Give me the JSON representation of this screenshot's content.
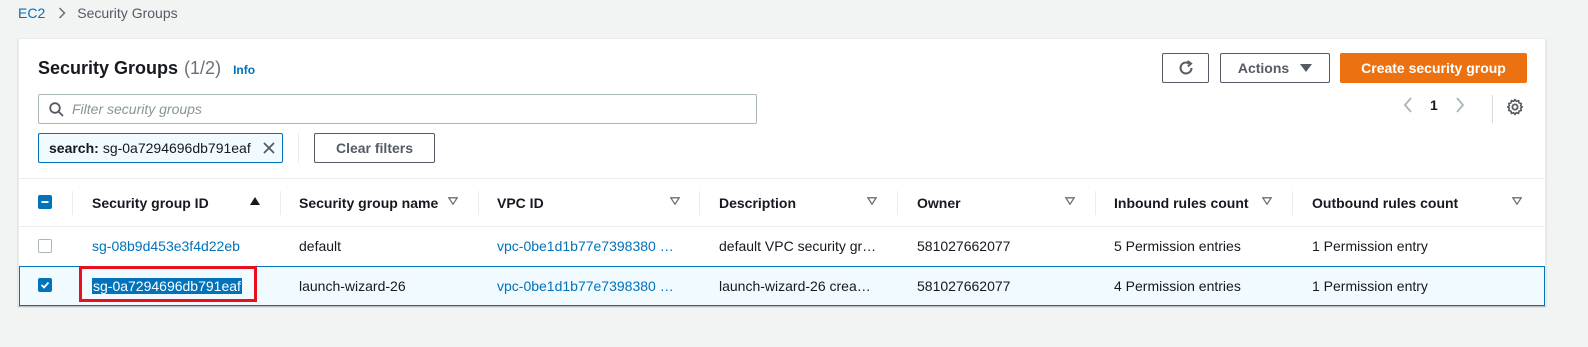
{
  "breadcrumb": {
    "root": "EC2",
    "current": "Security Groups"
  },
  "panel": {
    "title": "Security Groups",
    "count": "(1/2)",
    "info": "Info",
    "refresh_icon": "refresh-icon",
    "actions_label": "Actions",
    "create_label": "Create security group"
  },
  "search": {
    "placeholder": "Filter security groups",
    "value": ""
  },
  "filter_token": {
    "key": "search:",
    "value": "sg-0a7294696db791eaf"
  },
  "clear_filters_label": "Clear filters",
  "pagination": {
    "current_page": "1"
  },
  "columns": [
    {
      "label": "Security group ID",
      "sort": "ascending"
    },
    {
      "label": "Security group name"
    },
    {
      "label": "VPC ID"
    },
    {
      "label": "Description"
    },
    {
      "label": "Owner"
    },
    {
      "label": "Inbound rules count"
    },
    {
      "label": "Outbound rules count"
    }
  ],
  "rows": [
    {
      "selected": false,
      "sg_id": "sg-08b9d453e3f4d22eb",
      "sg_name": "default",
      "vpc_id": "vpc-0be1d1b77e7398380 …",
      "description": "default VPC security gr…",
      "owner": "581027662077",
      "inbound": "5 Permission entries",
      "outbound": "1 Permission entry"
    },
    {
      "selected": true,
      "sg_id": "sg-0a7294696db791eaf",
      "sg_name": "launch-wizard-26",
      "vpc_id": "vpc-0be1d1b77e7398380 …",
      "description": "launch-wizard-26 crea…",
      "owner": "581027662077",
      "inbound": "4 Permission entries",
      "outbound": "1 Permission entry"
    }
  ],
  "colors": {
    "link": "#0073bb",
    "primary_button": "#ec7211",
    "highlight": "#e8101c",
    "selected_row_bg": "#f1faff"
  }
}
